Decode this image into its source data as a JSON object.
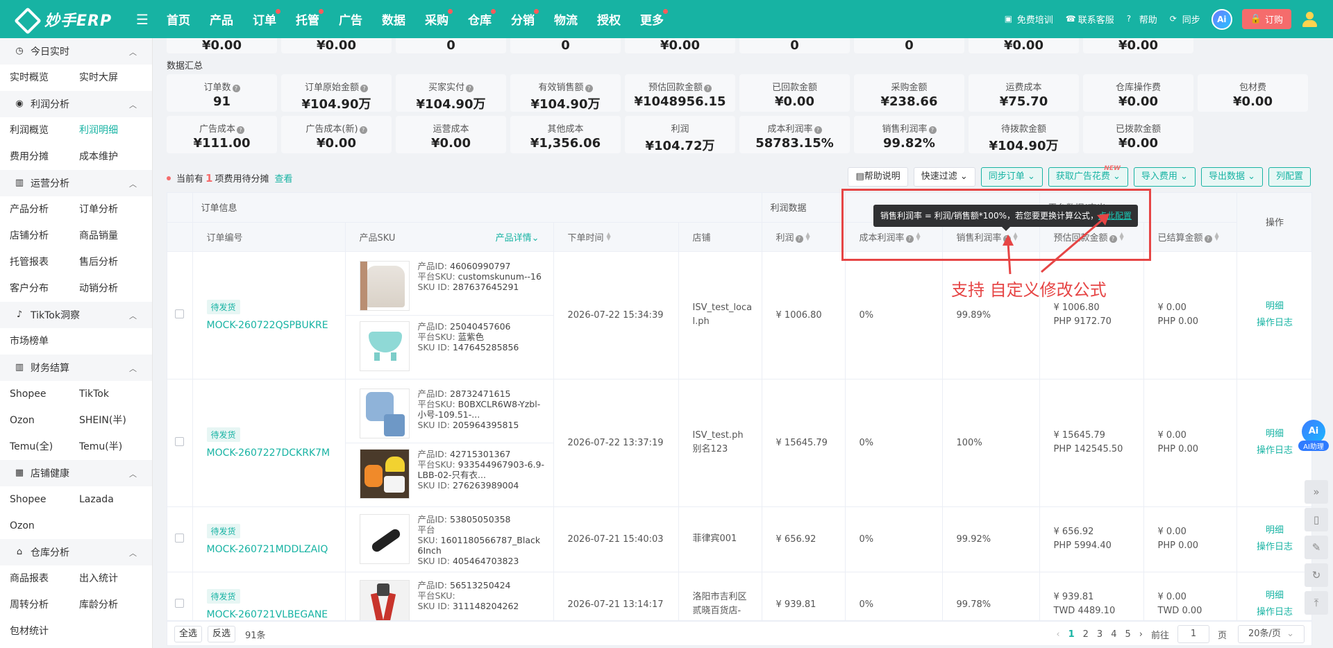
{
  "header": {
    "logo_text": "妙手ERP",
    "nav": [
      {
        "label": "首页",
        "dot": false
      },
      {
        "label": "产品",
        "dot": false
      },
      {
        "label": "订单",
        "dot": true
      },
      {
        "label": "托管",
        "dot": true
      },
      {
        "label": "广告",
        "dot": false
      },
      {
        "label": "数据",
        "dot": false
      },
      {
        "label": "采购",
        "dot": true
      },
      {
        "label": "仓库",
        "dot": true
      },
      {
        "label": "分销",
        "dot": true
      },
      {
        "label": "物流",
        "dot": false
      },
      {
        "label": "授权",
        "dot": false
      },
      {
        "label": "更多",
        "dot": true
      }
    ],
    "links": [
      "免费培训",
      "联系客服",
      "帮助",
      "同步"
    ],
    "ai_label": "Ai",
    "buy_label": "订购"
  },
  "sidebar": {
    "groups": [
      {
        "title": "今日实时",
        "icon": "clock-icon",
        "items": [
          "实时概览",
          "实时大屏"
        ]
      },
      {
        "title": "利润分析",
        "icon": "coin-icon",
        "items": [
          "利润概览",
          "利润明细",
          "费用分摊",
          "成本维护"
        ],
        "active": "利润明细"
      },
      {
        "title": "运营分析",
        "icon": "bar-chart-icon",
        "items": [
          "产品分析",
          "订单分析",
          "店铺分析",
          "商品销量",
          "托管报表",
          "售后分析",
          "客户分布",
          "动销分析"
        ]
      },
      {
        "title": "TikTok洞察",
        "icon": "tiktok-icon",
        "items": [
          "市场榜单"
        ]
      },
      {
        "title": "财务结算",
        "icon": "bar-chart-icon",
        "items": [
          "Shopee",
          "TikTok",
          "Ozon",
          "SHEIN(半)",
          "Temu(全)",
          "Temu(半)"
        ]
      },
      {
        "title": "店铺健康",
        "icon": "store-icon",
        "items": [
          "Shopee",
          "Lazada",
          "Ozon"
        ]
      },
      {
        "title": "仓库分析",
        "icon": "warehouse-icon",
        "items": [
          "商品报表",
          "出入统计",
          "周转分析",
          "库龄分析",
          "包材统计"
        ]
      }
    ]
  },
  "top_values": [
    "¥0.00",
    "¥0.00",
    "0",
    "0",
    "¥0.00",
    "0",
    "0",
    "¥0.00",
    "¥0.00"
  ],
  "summary": {
    "title": "数据汇总",
    "row1": [
      {
        "label": "订单数",
        "q": true,
        "value": "91"
      },
      {
        "label": "订单原始金额",
        "q": true,
        "value": "¥104.90万"
      },
      {
        "label": "买家实付",
        "q": true,
        "value": "¥104.90万"
      },
      {
        "label": "有效销售额",
        "q": true,
        "value": "¥104.90万"
      },
      {
        "label": "预估回款金额",
        "q": true,
        "value": "¥1048956.15"
      },
      {
        "label": "已回款金额",
        "q": false,
        "value": "¥0.00"
      },
      {
        "label": "采购金额",
        "q": false,
        "value": "¥238.66"
      },
      {
        "label": "运费成本",
        "q": false,
        "value": "¥75.70"
      },
      {
        "label": "仓库操作费",
        "q": false,
        "value": "¥0.00"
      },
      {
        "label": "包材费",
        "q": false,
        "value": "¥0.00"
      }
    ],
    "row2": [
      {
        "label": "广告成本",
        "q": true,
        "value": "¥111.00"
      },
      {
        "label": "广告成本(新)",
        "q": true,
        "value": "¥0.00"
      },
      {
        "label": "运营成本",
        "q": false,
        "value": "¥0.00"
      },
      {
        "label": "其他成本",
        "q": false,
        "value": "¥1,356.06"
      },
      {
        "label": "利润",
        "q": false,
        "value": "¥104.72万"
      },
      {
        "label": "成本利润率",
        "q": true,
        "value": "58783.15%"
      },
      {
        "label": "销售利润率",
        "q": true,
        "value": "99.82%"
      },
      {
        "label": "待拨款金额",
        "q": false,
        "value": "¥104.90万"
      },
      {
        "label": "已拨款金额",
        "q": false,
        "value": "¥0.00"
      }
    ]
  },
  "toolbar": {
    "pending_prefix": "当前有",
    "pending_count": "1",
    "pending_suffix": "项费用待分摊",
    "view_link": "查看",
    "buttons": [
      "帮助说明",
      "快速过滤",
      "同步订单",
      "获取广告花费",
      "导入费用",
      "导出数据",
      "列配置"
    ],
    "new_tag": "NEW"
  },
  "table": {
    "groups": [
      "订单信息",
      "利润数据",
      "平台数据(查出",
      "操作"
    ],
    "columns": [
      "订单编号",
      "产品SKU",
      "产品详情",
      "下单时间",
      "店铺",
      "利润",
      "成本利润率",
      "销售利润率",
      "预估回款金额",
      "已结算金额"
    ],
    "sku_labels": {
      "pid": "产品ID:",
      "psku": "平台SKU:",
      "skuid": "SKU ID:"
    },
    "rows": [
      {
        "status": "待发货",
        "order_no": "MOCK-260722QSPBUKRE",
        "skus": [
          {
            "pid": "46060990797",
            "psku": "customskunum--16",
            "skuid": "287637645291",
            "img": "shirt"
          },
          {
            "pid": "25040457606",
            "psku": "蓝紫色",
            "skuid": "147645285856",
            "img": "bowl"
          }
        ],
        "time": "2026-07-22 15:34:39",
        "store": "ISV_test_local.ph",
        "profit": "¥ 1006.80",
        "cost_rate": "0%",
        "sales_rate": "99.89%",
        "est1": "¥ 1006.80",
        "est2": "PHP 9172.70",
        "settled1": "¥ 0.00",
        "settled2": "PHP 0.00"
      },
      {
        "status": "待发货",
        "order_no": "MOCK-2607227DCKRK7M",
        "skus": [
          {
            "pid": "28732471615",
            "psku": "B0BXCLR6W8-Yzbl-小号-109.51-...",
            "skuid": "205964395815",
            "img": "outfit"
          },
          {
            "pid": "42715301367",
            "psku": "933544967903-6.9-LBB-02-只有衣...",
            "skuid": "276263989004",
            "img": "hat"
          }
        ],
        "time": "2026-07-22 13:37:19",
        "store": "ISV_test.ph 别名123",
        "profit": "¥ 15645.79",
        "cost_rate": "0%",
        "sales_rate": "100%",
        "est1": "¥ 15645.79",
        "est2": "PHP 142545.50",
        "settled1": "¥ 0.00",
        "settled2": "PHP 0.00"
      },
      {
        "status": "待发货",
        "order_no": "MOCK-260721MDDLZAIQ",
        "skus": [
          {
            "pid": "53805050358",
            "psku": "1601180566787_Black 6Inch",
            "skuid": "405464703823",
            "img": "black"
          }
        ],
        "time": "2026-07-21 15:40:03",
        "store": "菲律宾001",
        "profit": "¥ 656.92",
        "cost_rate": "0%",
        "sales_rate": "99.92%",
        "est1": "¥ 656.92",
        "est2": "PHP 5994.40",
        "settled1": "¥ 0.00",
        "settled2": "PHP 0.00"
      },
      {
        "status": "待发货",
        "order_no": "MOCK-260721VLBEGANE",
        "skus": [
          {
            "pid": "56513250424",
            "psku": "",
            "skuid": "311148204262",
            "img": "tool"
          }
        ],
        "time": "2026-07-21 13:14:17",
        "store": "洛阳市吉利区贰晓百货店-",
        "profit": "¥ 939.81",
        "cost_rate": "0%",
        "sales_rate": "99.78%",
        "est1": "¥ 939.81",
        "est2": "TWD 4489.10",
        "settled1": "¥ 0.00",
        "settled2": "TWD 0.00"
      }
    ],
    "op_labels": [
      "明细",
      "操作日志"
    ]
  },
  "tooltip": {
    "text": "销售利润率 = 利润/销售额*100%，若您要更换计算公式，",
    "link": "点此配置"
  },
  "annotation": "支持 自定义修改公式",
  "footer": {
    "select_all": "全选",
    "invert": "反选",
    "total": "91条",
    "pages": [
      "1",
      "2",
      "3",
      "4",
      "5"
    ],
    "goto_label": "前往",
    "goto_value": "1",
    "page_unit": "页",
    "page_size": "20条/页"
  },
  "ai_helper": {
    "icon_label": "Ai",
    "label": "AI助理"
  },
  "colors": {
    "brand": "#17b3a3",
    "alert": "#e64545"
  }
}
